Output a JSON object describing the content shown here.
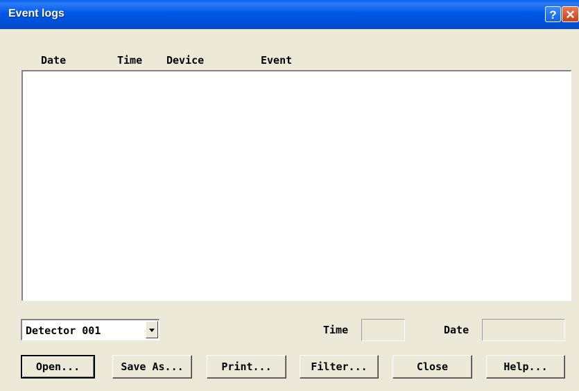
{
  "window": {
    "title": "Event logs",
    "help_glyph": "?",
    "close_glyph": "✕"
  },
  "list": {
    "columns": [
      "Date",
      "Time",
      "Device",
      "Event"
    ],
    "rows": []
  },
  "device_select": {
    "value": "Detector 001"
  },
  "time": {
    "label": "Time",
    "value": ""
  },
  "date": {
    "label": "Date",
    "value": ""
  },
  "buttons": {
    "open": "Open...",
    "save_as": "Save As...",
    "print": "Print...",
    "filter": "Filter...",
    "close": "Close",
    "help": "Help..."
  }
}
